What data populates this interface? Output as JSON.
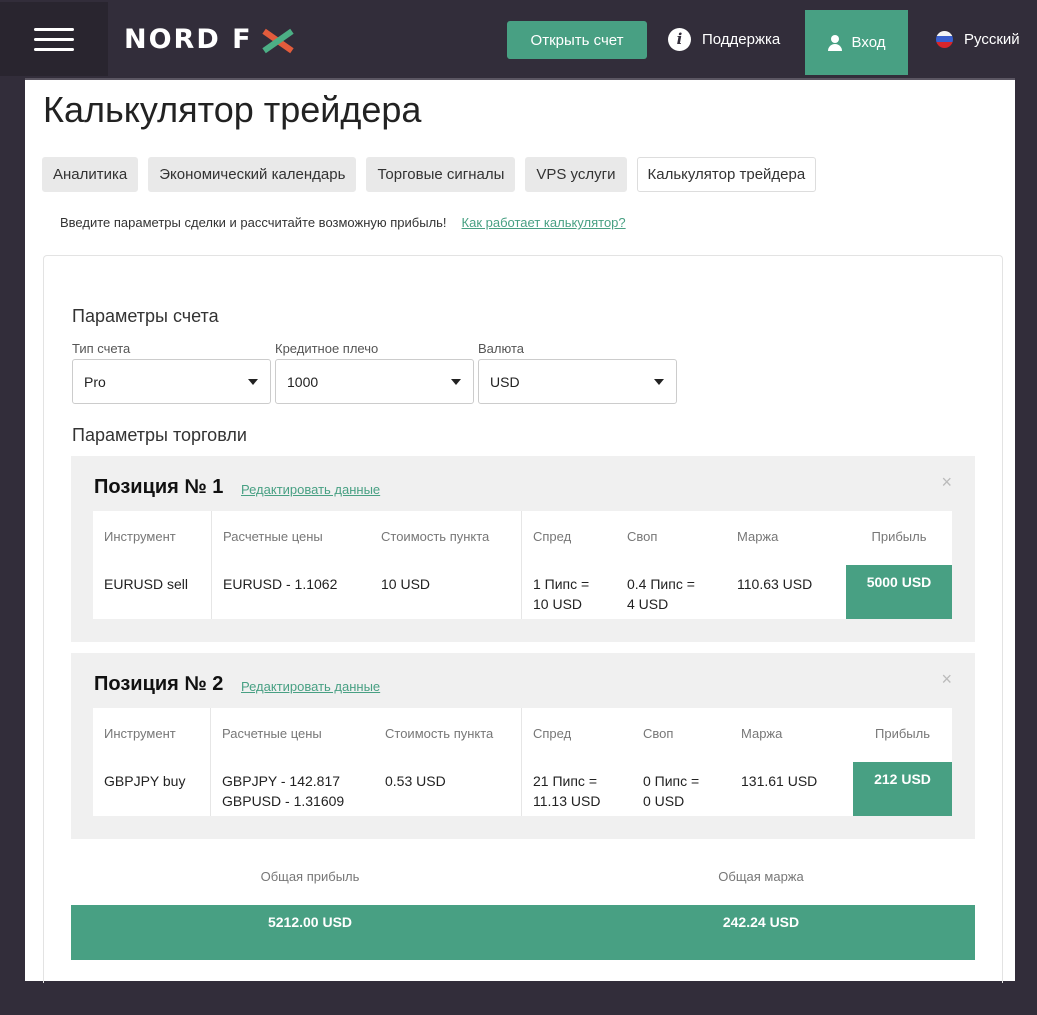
{
  "header": {
    "logo_text": "NORD F",
    "open_account": "Открыть счет",
    "support": "Поддержка",
    "login": "Вход",
    "language": "Русский",
    "colors": {
      "background": "#322d3a",
      "accent": "#48a083"
    }
  },
  "page": {
    "title": "Калькулятор трейдера",
    "tabs": [
      {
        "label": "Аналитика",
        "active": false
      },
      {
        "label": "Экономический календарь",
        "active": false
      },
      {
        "label": "Торговые сигналы",
        "active": false
      },
      {
        "label": "VPS услуги",
        "active": false
      },
      {
        "label": "Калькулятор трейдера",
        "active": true
      }
    ],
    "intro_text": "Введите параметры сделки и рассчитайте возможную прибыль!",
    "intro_link": "Как работает калькулятор?"
  },
  "account": {
    "section_title": "Параметры счета",
    "type_label": "Тип счета",
    "type_value": "Pro",
    "leverage_label": "Кредитное плечо",
    "leverage_value": "1000",
    "currency_label": "Валюта",
    "currency_value": "USD"
  },
  "trading": {
    "section_title": "Параметры торговли",
    "edit_label": "Редактировать данные",
    "close_glyph": "×",
    "headers": {
      "instrument": "Инструмент",
      "prices": "Расчетные цены",
      "pip_value": "Стоимость пункта",
      "spread": "Спред",
      "swap": "Своп",
      "margin": "Маржа",
      "profit": "Прибыль"
    },
    "positions": [
      {
        "title": "Позиция № 1",
        "instrument": "EURUSD sell",
        "prices": [
          "EURUSD - 1.1062"
        ],
        "pip_value": "10 USD",
        "spread": [
          "1 Пипс =",
          "10 USD"
        ],
        "swap": [
          "0.4 Пипс =",
          "4 USD"
        ],
        "margin": "110.63 USD",
        "profit": "5000 USD"
      },
      {
        "title": "Позиция № 2",
        "instrument": "GBPJPY buy",
        "prices": [
          "GBPJPY - 142.817",
          "GBPUSD - 1.31609"
        ],
        "pip_value": "0.53 USD",
        "spread": [
          "21 Пипс =",
          "11.13 USD"
        ],
        "swap": [
          "0 Пипс =",
          "0 USD"
        ],
        "margin": "131.61 USD",
        "profit": "212 USD"
      }
    ]
  },
  "totals": {
    "profit_label": "Общая прибыль",
    "profit_value": "5212.00 USD",
    "margin_label": "Общая маржа",
    "margin_value": "242.24 USD"
  }
}
